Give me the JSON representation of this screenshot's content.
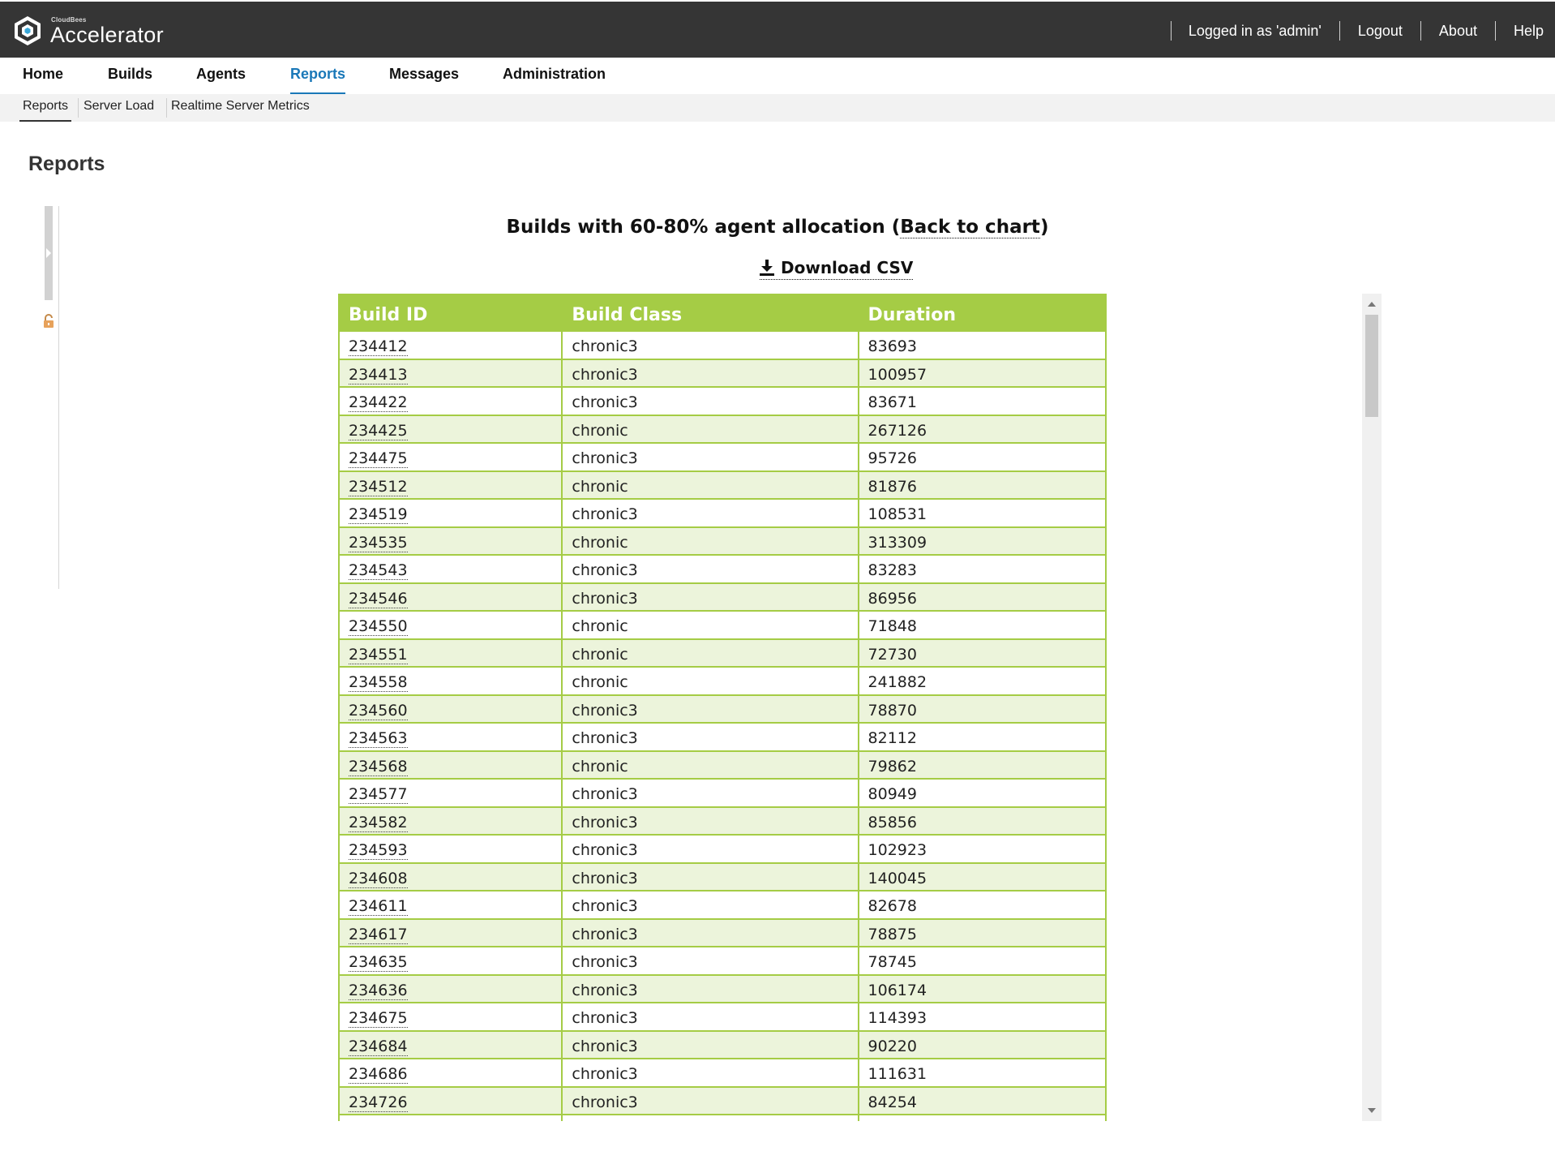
{
  "header": {
    "brand_small": "CloudBees",
    "brand_name": "Accelerator",
    "logged_in": "Logged in as 'admin'",
    "logout": "Logout",
    "about": "About",
    "help": "Help"
  },
  "nav": {
    "items": [
      "Home",
      "Builds",
      "Agents",
      "Reports",
      "Messages",
      "Administration"
    ],
    "active": "Reports"
  },
  "subnav": {
    "items": [
      "Reports",
      "Server Load",
      "Realtime Server Metrics"
    ],
    "active": "Reports"
  },
  "page": {
    "title": "Reports"
  },
  "report": {
    "heading_prefix": "Builds with 60-80% agent allocation (",
    "back_link": "Back to chart",
    "heading_suffix": ")",
    "download_label": "Download CSV",
    "columns": [
      "Build ID",
      "Build Class",
      "Duration"
    ],
    "rows": [
      [
        "234412",
        "chronic3",
        "83693"
      ],
      [
        "234413",
        "chronic3",
        "100957"
      ],
      [
        "234422",
        "chronic3",
        "83671"
      ],
      [
        "234425",
        "chronic",
        "267126"
      ],
      [
        "234475",
        "chronic3",
        "95726"
      ],
      [
        "234512",
        "chronic",
        "81876"
      ],
      [
        "234519",
        "chronic3",
        "108531"
      ],
      [
        "234535",
        "chronic",
        "313309"
      ],
      [
        "234543",
        "chronic3",
        "83283"
      ],
      [
        "234546",
        "chronic3",
        "86956"
      ],
      [
        "234550",
        "chronic",
        "71848"
      ],
      [
        "234551",
        "chronic",
        "72730"
      ],
      [
        "234558",
        "chronic",
        "241882"
      ],
      [
        "234560",
        "chronic3",
        "78870"
      ],
      [
        "234563",
        "chronic3",
        "82112"
      ],
      [
        "234568",
        "chronic",
        "79862"
      ],
      [
        "234577",
        "chronic3",
        "80949"
      ],
      [
        "234582",
        "chronic3",
        "85856"
      ],
      [
        "234593",
        "chronic3",
        "102923"
      ],
      [
        "234608",
        "chronic3",
        "140045"
      ],
      [
        "234611",
        "chronic3",
        "82678"
      ],
      [
        "234617",
        "chronic3",
        "78875"
      ],
      [
        "234635",
        "chronic3",
        "78745"
      ],
      [
        "234636",
        "chronic3",
        "106174"
      ],
      [
        "234675",
        "chronic3",
        "114393"
      ],
      [
        "234684",
        "chronic3",
        "90220"
      ],
      [
        "234686",
        "chronic3",
        "111631"
      ],
      [
        "234726",
        "chronic3",
        "84254"
      ],
      [
        "",
        "",
        ""
      ]
    ]
  },
  "icons": {
    "logo": "cloudbees-hexagon-logo",
    "download": "download-icon",
    "lock": "unlocked-lock-icon",
    "panel_toggle": "chevron-right-icon"
  },
  "colors": {
    "header_bg": "#353535",
    "accent": "#1a78b8",
    "table_header": "#a5cc45",
    "row_alt": "#ecf4db"
  }
}
